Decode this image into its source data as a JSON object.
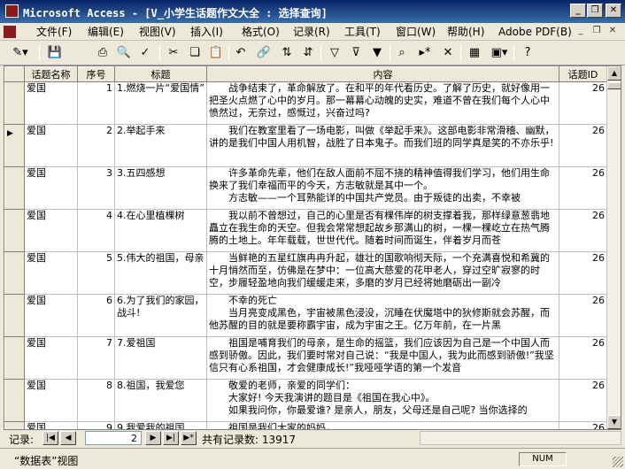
{
  "window": {
    "title": "Microsoft Access - [V_小学生话题作文大全 : 选择查询]",
    "app_icon": "access-icon"
  },
  "menu": [
    "文件(F)",
    "编辑(E)",
    "视图(V)",
    "插入(I)",
    "格式(O)",
    "记录(R)",
    "工具(T)",
    "窗口(W)",
    "帮助(H)",
    "Adobe PDF(B)"
  ],
  "toolbar": {
    "icons": [
      "design-view-icon",
      "save-icon",
      "print-icon",
      "print-preview-icon",
      "spelling-icon",
      "cut-icon",
      "copy-icon",
      "paste-icon",
      "undo-icon",
      "hyperlink-icon",
      "sort-asc-icon",
      "sort-desc-icon",
      "filter-selection-icon",
      "filter-form-icon",
      "apply-filter-icon",
      "find-icon",
      "new-record-icon",
      "delete-record-icon",
      "database-window-icon",
      "new-object-icon",
      "help-icon"
    ]
  },
  "grid": {
    "columns": [
      "话题名称",
      "序号",
      "标题",
      "内容",
      "话题ID"
    ],
    "rows": [
      {
        "topic": "爱国",
        "seq": "1",
        "title": "1.燃烧一片“爱国情”",
        "content": "　　战争结束了，革命解放了。在和平的年代看历史。了解了历史，就好像用一把圣火点燃了心中的岁月。那一幕幕心动魄的史实，难道不曾在我们每个人心中愤然过，无奈过，感慨过，兴奋过吗?",
        "id": "26"
      },
      {
        "topic": "爱国",
        "seq": "2",
        "title": "2.举起手来",
        "content": "　　我们在教室里看了一场电影，叫做《举起手来》。这部电影非常滑稽、幽默，讲的是我们中国人用机智，战胜了日本鬼子。而我们班的同学真是笑的不亦乐乎!",
        "id": "26"
      },
      {
        "topic": "爱国",
        "seq": "3",
        "title": "3.五四感想",
        "content": "　　许多革命先辈，他们在敌人面前不屈不挠的精神值得我们学习，他们用生命换来了我们幸福而平的今天，方志敏就是其中一个。\n　　方志敏——一个耳熟能详的中国共产党员。由于叛徒的出卖，不幸被",
        "id": "26"
      },
      {
        "topic": "爱国",
        "seq": "4",
        "title": "4.在心里植棵树",
        "content": "　　我以前不曾想过，自己的心里是否有棵伟岸的树支撑着我，那样绿意葱翡地矗立在我生命的天空。但我会常常想起故乡那满山的树，一棵一棵屹立在热气腾腾的土地上。年年载载，世世代代。随着时间而诞生，伴着岁月而苍",
        "id": "26"
      },
      {
        "topic": "爱国",
        "seq": "5",
        "title": "5.伟大的祖国，母亲",
        "content": "　　当鲜艳的五星红旗冉冉升起，雄壮的国歌响彻天际，一个充满喜悦和希冀的十月悄然而至，仿佛是在梦中：一位高大慈爱的花甲老人，穿过空旷寂寥的时空，步履轻盈地向我们缓缓走来，多磨的岁月已经将她磨砺出一副冷",
        "id": "26"
      },
      {
        "topic": "爱国",
        "seq": "6",
        "title": "6.为了我们的家园，战斗!",
        "content": "　　不幸的死亡\n　　当月亮变成黑色，宇宙被黑色浸没，沉睡在伏魔塔中的狄修斯就会苏醒，而他苏醒的目的就是要称霸宇宙，成为宇宙之王。亿万年前，在一片黑",
        "id": "26"
      },
      {
        "topic": "爱国",
        "seq": "7",
        "title": "7.爱祖国",
        "content": "　　祖国是哺育我们的母亲，是生命的摇篮，我们应该因为自己是一个中国人而感到骄傲。因此，我们要时常对自己说：“我是中国人，我为此而感到骄傲!”我坚信只有心系祖国，才会健康成长!”我哑哑学语的第一个发音",
        "id": "26"
      },
      {
        "topic": "爱国",
        "seq": "8",
        "title": "8.祖国，我爱您",
        "content": "　　敬爱的老师，亲爱的同学们：\n　　大家好! 今天我演讲的题目是《祖国在我心中》。\n　　如果我问你，你最爱谁? 是亲人，朋友，父母还是自己呢? 当你选择的",
        "id": "26"
      },
      {
        "topic": "爱国",
        "seq": "9",
        "title": "9.我爱我的祖国",
        "content": "　　祖国是我们大家的妈妈，",
        "id": "26"
      }
    ],
    "current_row_index": 1
  },
  "nav": {
    "label": "记录:",
    "current": "2",
    "total_label": "共有记录数: 13917"
  },
  "status": {
    "text": "“数据表”视图",
    "num": "NUM"
  }
}
